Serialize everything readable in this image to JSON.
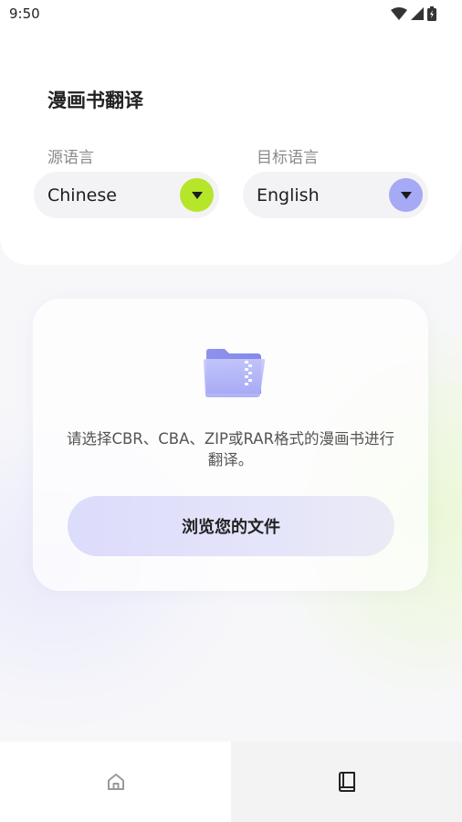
{
  "status_bar": {
    "time": "9:50",
    "icons": [
      "wifi-icon",
      "signal-icon",
      "battery-icon"
    ]
  },
  "header": {
    "title": "漫画书翻译"
  },
  "source_language": {
    "label": "源语言",
    "value": "Chinese",
    "dropdown_color": "#b5e62a"
  },
  "target_language": {
    "label": "目标语言",
    "value": "English",
    "dropdown_color": "#a6a9f4"
  },
  "upload": {
    "icon": "folder-zip-icon",
    "hint": "请选择CBR、CBA、ZIP或RAR格式的漫画书进行翻译。",
    "button_label": "浏览您的文件"
  },
  "bottom_nav": {
    "items": [
      {
        "icon": "home-icon",
        "active": false
      },
      {
        "icon": "book-icon",
        "active": true
      }
    ]
  }
}
